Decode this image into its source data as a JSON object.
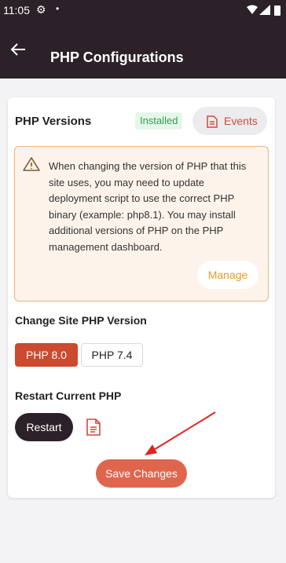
{
  "status_bar": {
    "time": "11:05"
  },
  "app_bar": {
    "title": "PHP Configurations"
  },
  "versions": {
    "title": "PHP Versions",
    "badge": "Installed",
    "events_label": "Events"
  },
  "warning": {
    "text": "When changing the version of PHP that this site uses, you may need to update deployment script to use the correct PHP binary (example: php8.1). You may install additional versions of PHP on the PHP management dashboard.",
    "manage_label": "Manage"
  },
  "change_version": {
    "title": "Change Site PHP Version",
    "options": [
      "PHP 8.0",
      "PHP 7.4"
    ],
    "selected": "PHP 8.0"
  },
  "restart": {
    "title": "Restart Current PHP",
    "button_label": "Restart"
  },
  "save_label": "Save Changes",
  "colors": {
    "header": "#2c2128",
    "accent": "#cc4a30",
    "save": "#e0654d",
    "installed": "#2e9f4e",
    "manage": "#e69c2a"
  }
}
